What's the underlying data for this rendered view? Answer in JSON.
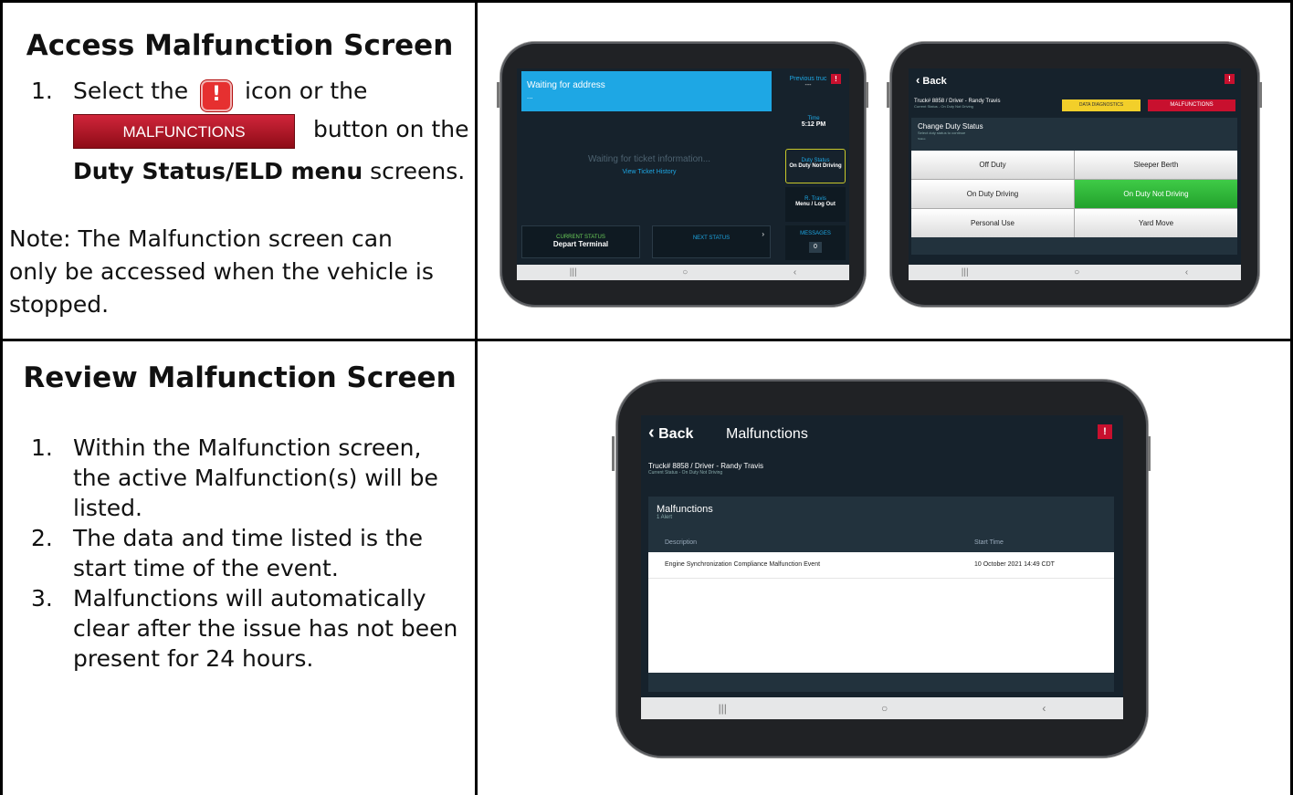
{
  "section1": {
    "title": "Access Malfunction Screen",
    "step_num": "1.",
    "step_part1": "Select the",
    "alert_glyph": "!",
    "step_part2": "icon or the",
    "button_label": "MALFUNCTIONS",
    "step_part3": "button on the",
    "step_bold": "Duty Status/ELD menu",
    "step_part4": "screens.",
    "note": "Note: The Malfunction screen can only be accessed when the vehicle is stopped."
  },
  "section2": {
    "title": "Review Malfunction Screen",
    "items": [
      {
        "num": "1.",
        "text": "Within the Malfunction screen, the active Malfunction(s) will be listed."
      },
      {
        "num": "2.",
        "text": "The data and time listed is the start time of the event."
      },
      {
        "num": "3.",
        "text": "Malfunctions will automatically clear after the issue has not been present for 24 hours."
      }
    ]
  },
  "tablet1": {
    "banner_title": "Waiting for address",
    "banner_sub": "...",
    "waiting": "Waiting for ticket information...",
    "view_history": "View Ticket History",
    "previous_truck": "Previous truc",
    "previous_value": "---",
    "time_label": "Time",
    "time_value": "5:12 PM",
    "duty_label": "Duty Status",
    "duty_value": "On Duty Not Driving",
    "user_label": "R. Travis",
    "user_value": "Menu / Log Out",
    "messages_label": "MESSAGES",
    "messages_count": "0",
    "current_status_label": "CURRENT STATUS",
    "current_status_value": "Depart Terminal",
    "next_status_label": "NEXT STATUS",
    "alert_glyph": "!"
  },
  "tablet2": {
    "back": "Back",
    "truck_line": "Truck# 8858 / Driver - Randy Travis",
    "current_status": "Current Status - On Duty Not Driving",
    "data_diag": "DATA DIAGNOSTICS",
    "malfunctions": "MALFUNCTIONS",
    "change_title": "Change Duty Status",
    "change_sub": "Select duty status to continue",
    "status_label": "Status",
    "options": [
      "Off Duty",
      "Sleeper Berth",
      "On Duty Driving",
      "On Duty Not Driving",
      "Personal Use",
      "Yard Move"
    ],
    "alert_glyph": "!"
  },
  "tablet3": {
    "back": "Back",
    "title": "Malfunctions",
    "truck_line": "Truck# 8858 / Driver - Randy Travis",
    "current_status": "Current Status - On Duty Not Driving",
    "panel_title": "Malfunctions",
    "panel_sub": "1 Alert",
    "col_description": "Description",
    "col_start": "Start Time",
    "row_description": "Engine Synchronization Compliance Malfunction Event",
    "row_start": "10 October 2021 14:49 CDT",
    "alert_glyph": "!"
  },
  "colors": {
    "accent_blue": "#1ea7e4",
    "active_green": "#2fb53b",
    "malfunction_red": "#c8102e",
    "diag_yellow": "#f2cf2a",
    "screen_dark": "#16222c"
  }
}
